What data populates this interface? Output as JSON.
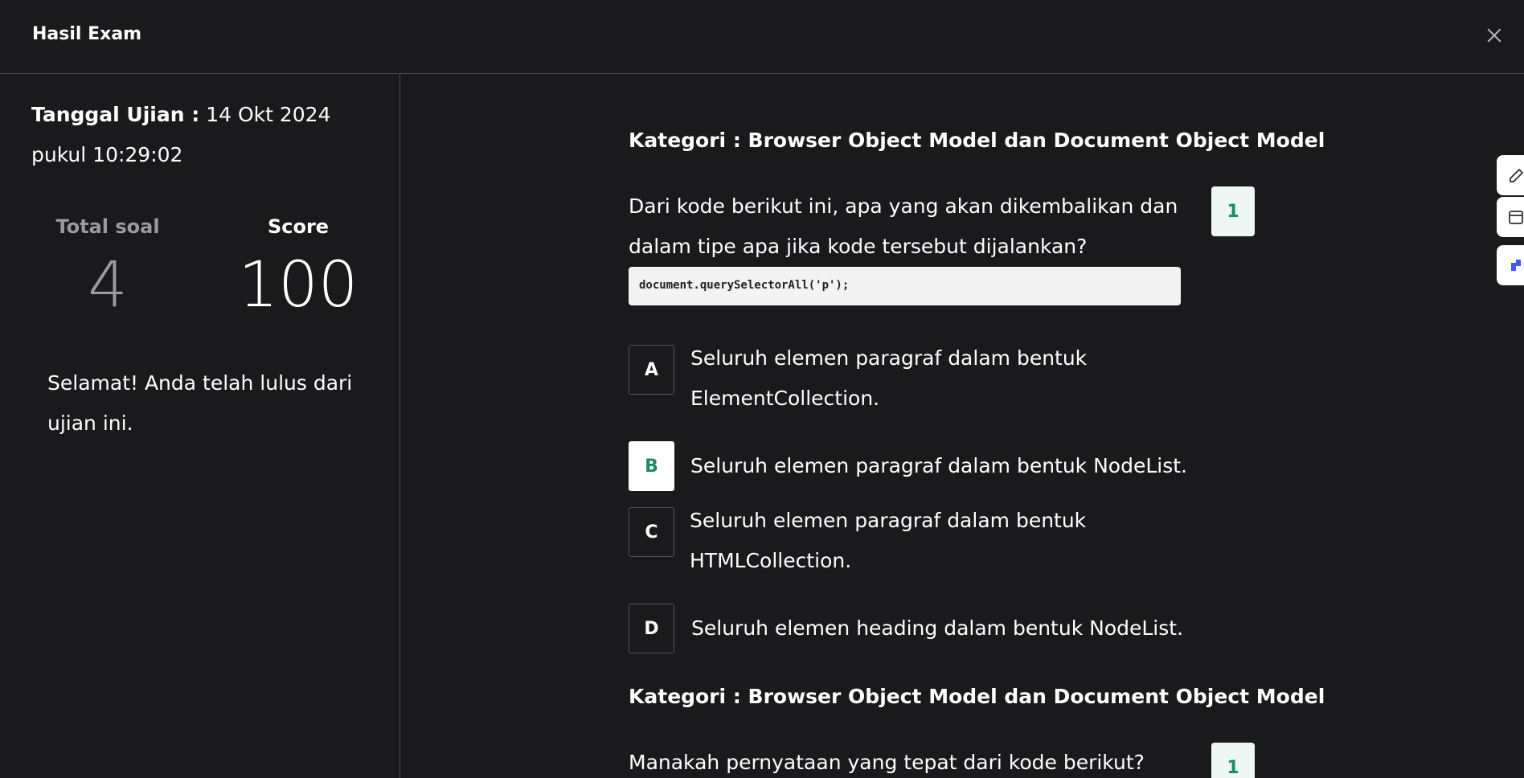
{
  "header": {
    "title": "Hasil Exam"
  },
  "summary": {
    "date_label": "Tanggal Ujian :",
    "date_value": "14 Okt 2024 pukul 10:29:02",
    "total_label": "Total soal",
    "total_value": "4",
    "score_label": "Score",
    "score_value": "100",
    "message": "Selamat! Anda telah lulus dari ujian ini."
  },
  "questions": [
    {
      "category": "Kategori : Browser Object Model dan Document Object Model",
      "text": "Dari kode berikut ini, apa yang akan dikembalikan dan dalam tipe apa jika kode tersebut dijalankan?",
      "code": "document.querySelectorAll('p');",
      "number": "1",
      "options": [
        {
          "letter": "A",
          "text": "Seluruh elemen paragraf dalam bentuk ElementCollection.",
          "selected": false
        },
        {
          "letter": "B",
          "text": "Seluruh elemen paragraf dalam bentuk NodeList.",
          "selected": true
        },
        {
          "letter": "C",
          "text": "Seluruh elemen paragraf dalam bentuk HTMLCollection.",
          "selected": false
        },
        {
          "letter": "D",
          "text": "Seluruh elemen heading dalam bentuk NodeList.",
          "selected": false
        }
      ]
    },
    {
      "category": "Kategori : Browser Object Model dan Document Object Model",
      "text": "Manakah pernyataan yang tepat dari kode berikut?",
      "number": "1"
    }
  ],
  "side_tabs": [
    {
      "icon": "edit-icon"
    },
    {
      "icon": "calendar-icon"
    },
    {
      "icon": "puzzle-icon"
    }
  ],
  "colors": {
    "background": "#1a1a1d",
    "correct_accent": "#1e8a6a",
    "number_badge_bg": "#eef7f3",
    "divider": "#4a4a4f"
  }
}
